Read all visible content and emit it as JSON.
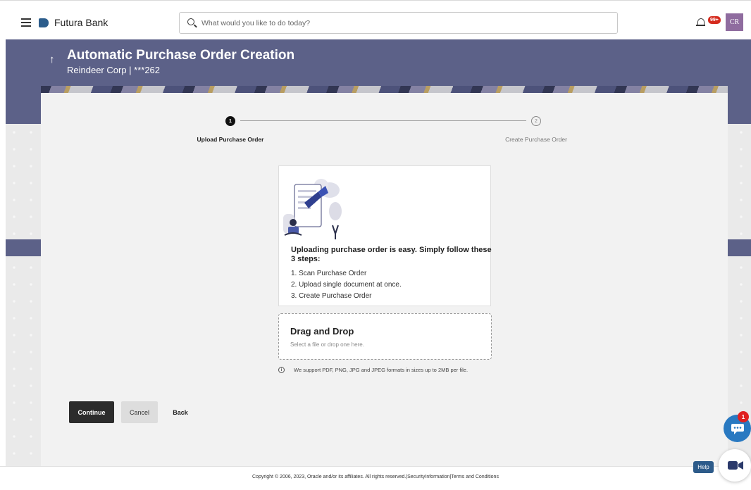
{
  "header": {
    "brand": "Futura Bank",
    "search_placeholder": "What would you like to do today?",
    "notification_badge": "99+",
    "avatar_initials": "CR"
  },
  "banner": {
    "title": "Automatic Purchase Order Creation",
    "subtitle": "Reindeer Corp | ***262"
  },
  "stepper": {
    "steps": [
      {
        "number": "1",
        "label": "Upload Purchase Order",
        "state": "active"
      },
      {
        "number": "2",
        "label": "Create Purchase Order",
        "state": "inactive"
      }
    ]
  },
  "info": {
    "heading": "Uploading purchase order is easy. Simply follow these 3 steps:",
    "steps": [
      "1. Scan Purchase Order",
      "2. Upload single document at once.",
      "3. Create Purchase Order"
    ]
  },
  "upload": {
    "title": "Drag and Drop",
    "subtitle": "Select a file or drop one here.",
    "support_note": "We support PDF, PNG, JPG and JPEG formats in sizes up to 2MB per file."
  },
  "actions": {
    "continue": "Continue",
    "cancel": "Cancel",
    "back": "Back"
  },
  "footer": {
    "copyright": "Copyright © 2006, 2023, Oracle and/or its affiliates. All rights reserved.|SecurityInformation|Terms and Conditions"
  },
  "floating": {
    "chat_badge": "1",
    "help_label": "Help"
  },
  "colors": {
    "banner": "#5c6188",
    "primary_button": "#2c2c2c",
    "avatar": "#8f6c9f",
    "chat": "#2979c1"
  }
}
